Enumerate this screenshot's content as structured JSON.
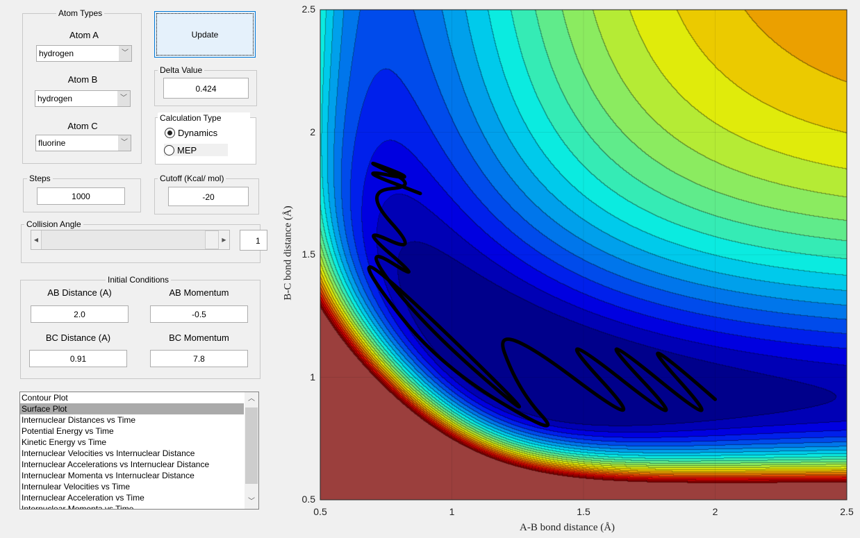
{
  "atom_types": {
    "title": "Atom Types",
    "atom_a_label": "Atom A",
    "atom_a": "hydrogen",
    "atom_b_label": "Atom B",
    "atom_b": "hydrogen",
    "atom_c_label": "Atom C",
    "atom_c": "fluorine"
  },
  "update_label": "Update",
  "delta": {
    "title": "Delta Value",
    "value": "0.424"
  },
  "calc_type": {
    "title": "Calculation Type",
    "options": [
      "Dynamics",
      "MEP"
    ],
    "selected": "Dynamics"
  },
  "steps": {
    "title": "Steps",
    "value": "1000"
  },
  "cutoff": {
    "title": "Cutoff (Kcal/ mol)",
    "value": "-20"
  },
  "collision": {
    "title": "Collision Angle",
    "value": "1"
  },
  "initial": {
    "title": "Initial Conditions",
    "ab_dist_label": "AB Distance (A)",
    "ab_dist": "2.0",
    "ab_mom_label": "AB Momentum",
    "ab_mom": "-0.5",
    "bc_dist_label": "BC Distance (A)",
    "bc_dist": "0.91",
    "bc_mom_label": "BC Momentum",
    "bc_mom": "7.8"
  },
  "plot_list": {
    "items": [
      "Contour Plot",
      "Surface Plot",
      "Internuclear Distances vs Time",
      "Potential Energy vs Time",
      "Kinetic Energy vs Time",
      "Internuclear Velocities vs Internuclear Distance",
      "Internuclear Accelerations vs Internuclear Distance",
      "Internuclear Momenta vs Internuclear Distance",
      "Internulear Velocities vs Time",
      "Internuclear Acceleration vs Time",
      "Internuclear Momenta vs Time"
    ],
    "selected_index": 1
  },
  "chart_data": {
    "type": "heatmap",
    "title": "",
    "xlabel": "A-B bond distance (Å)",
    "ylabel": "B-C bond distance (Å)",
    "xlim": [
      0.5,
      2.5
    ],
    "ylim": [
      0.5,
      2.5
    ],
    "xticks": [
      "0.5",
      "1",
      "1.5",
      "2",
      "2.5"
    ],
    "yticks": [
      "0.5",
      "1",
      "1.5",
      "2",
      "2.5"
    ],
    "colormap": "jet",
    "clamp_color": "#a84442",
    "trajectory": [
      [
        2.0,
        0.91
      ],
      [
        1.65,
        1.24
      ],
      [
        2.07,
        0.74
      ],
      [
        1.5,
        1.24
      ],
      [
        1.94,
        0.74
      ],
      [
        1.35,
        1.24
      ],
      [
        1.78,
        0.74
      ],
      [
        1.15,
        1.25
      ],
      [
        1.25,
        0.95
      ],
      [
        1.43,
        0.74
      ],
      [
        0.95,
        1.05
      ],
      [
        0.66,
        1.45
      ],
      [
        0.72,
        1.45
      ],
      [
        1.4,
        0.74
      ],
      [
        0.9,
        1.2
      ],
      [
        0.65,
        1.55
      ],
      [
        0.9,
        1.38
      ],
      [
        0.64,
        1.62
      ],
      [
        0.88,
        1.5
      ],
      [
        0.66,
        1.76
      ],
      [
        0.88,
        1.78
      ],
      [
        0.64,
        1.9
      ],
      [
        0.88,
        1.8
      ],
      [
        0.64,
        1.85
      ],
      [
        0.88,
        1.75
      ]
    ]
  }
}
